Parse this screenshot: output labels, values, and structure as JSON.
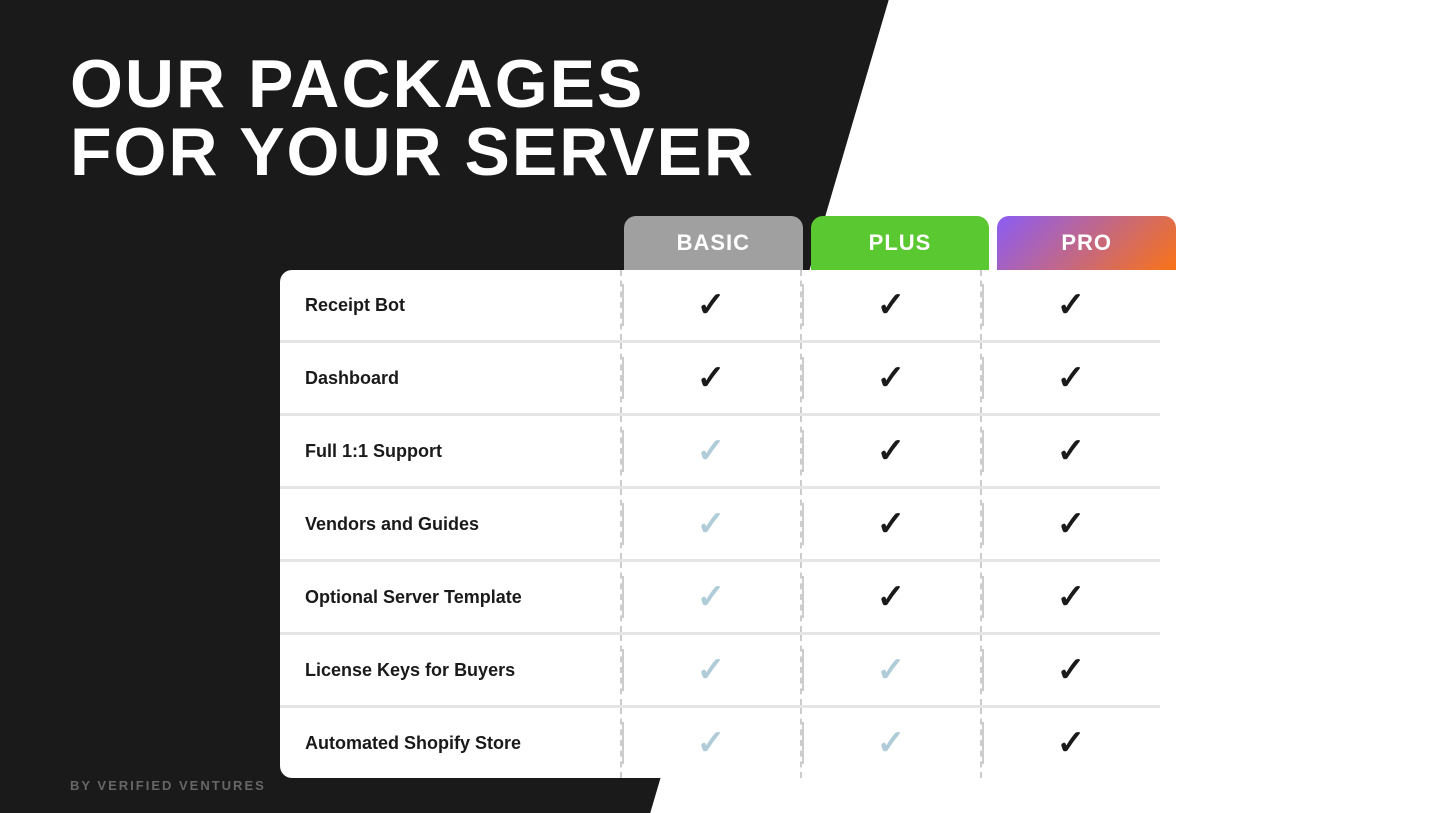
{
  "page": {
    "background": "#1a1a1a",
    "title_line1": "OUR PACKAGES",
    "title_line2": "FOR YOUR SERVER",
    "footer_text": "BY VERIFIED VENTURES"
  },
  "packages": {
    "basic": {
      "label": "BASIC",
      "color": "#a0a0a0"
    },
    "plus": {
      "label": "PLUS",
      "color": "#5ac830"
    },
    "pro": {
      "label": "PRO",
      "gradient": "linear-gradient(135deg, #8b5cf6 0%, #f97316 100%)"
    }
  },
  "features": [
    {
      "name": "Receipt Bot",
      "basic": "dark",
      "plus": "dark",
      "pro": "dark"
    },
    {
      "name": "Dashboard",
      "basic": "dark",
      "plus": "dark",
      "pro": "dark"
    },
    {
      "name": "Full 1:1 Support",
      "basic": "light",
      "plus": "dark",
      "pro": "dark"
    },
    {
      "name": "Vendors and Guides",
      "basic": "light",
      "plus": "dark",
      "pro": "dark"
    },
    {
      "name": "Optional Server Template",
      "basic": "light",
      "plus": "dark",
      "pro": "dark"
    },
    {
      "name": "License Keys for Buyers",
      "basic": "light",
      "plus": "light",
      "pro": "dark"
    },
    {
      "name": "Automated Shopify Store",
      "basic": "light",
      "plus": "light",
      "pro": "dark"
    }
  ]
}
